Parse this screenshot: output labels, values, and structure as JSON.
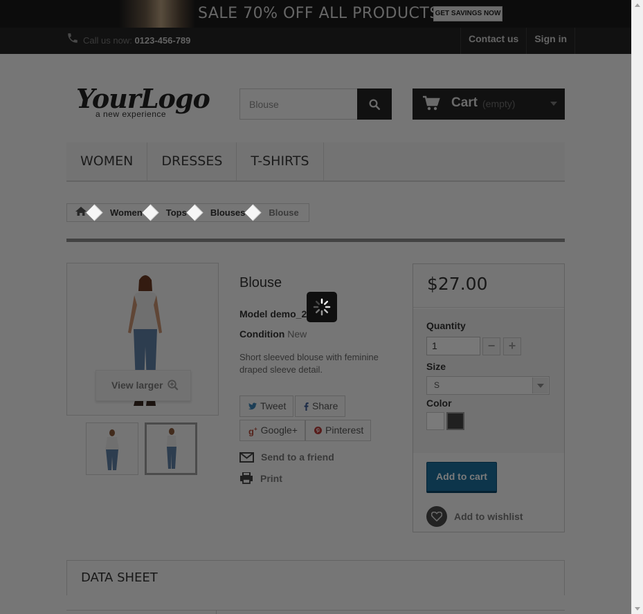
{
  "banner": {
    "text": "SALE 70% OFF ALL PRODUCTS",
    "button": "GET SAVINGS NOW"
  },
  "topbar": {
    "call_label": "Call us now:",
    "phone": "0123-456-789",
    "links": [
      "Contact us",
      "Sign in"
    ]
  },
  "logo": {
    "main": "YourLogo",
    "sub": "a new experience"
  },
  "search": {
    "value": "Blouse"
  },
  "cart": {
    "label": "Cart",
    "status": "(empty)"
  },
  "menu": [
    "WOMEN",
    "DRESSES",
    "T-SHIRTS"
  ],
  "breadcrumb": [
    "Women",
    "Tops",
    "Blouses",
    "Blouse"
  ],
  "product": {
    "title": "Blouse",
    "model": "Model demo_2",
    "condition_label": "Condition",
    "condition_value": "New",
    "description": "Short sleeved blouse with feminine draped sleeve detail.",
    "view_larger": "View larger",
    "share": {
      "tweet": "Tweet",
      "share": "Share",
      "google": "Google+",
      "pinterest": "Pinterest"
    },
    "send_friend": "Send to a friend",
    "print": "Print"
  },
  "buybox": {
    "price": "$27.00",
    "quantity_label": "Quantity",
    "quantity_value": "1",
    "size_label": "Size",
    "size_value": "S",
    "color_label": "Color",
    "colors": [
      "#ffffff",
      "#434343"
    ],
    "add_to_cart": "Add to cart",
    "wishlist": "Add to wishlist"
  },
  "datasheet": {
    "title": "DATA SHEET"
  },
  "colors": {
    "accent": "#2a8ac7",
    "dark": "#333333"
  }
}
